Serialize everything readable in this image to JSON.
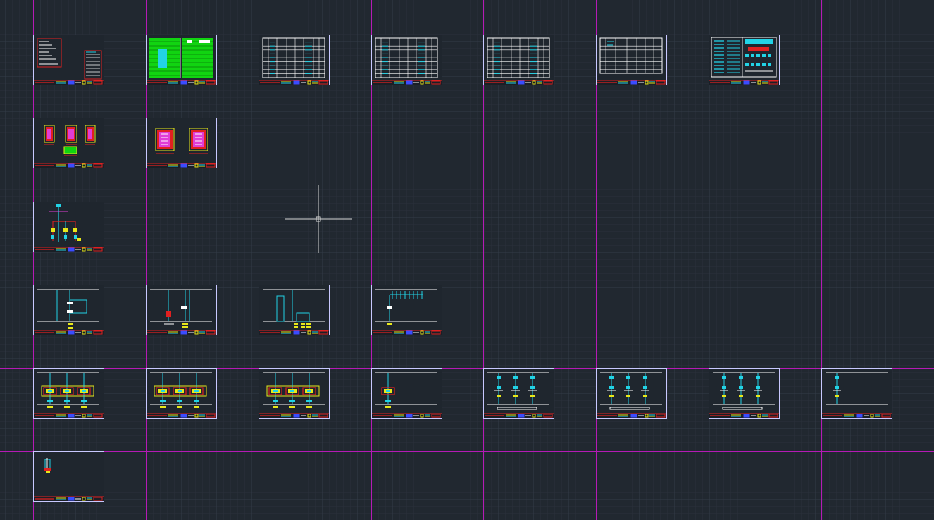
{
  "colors": {
    "background": "#212830",
    "grid_minor": "#2a313b",
    "grid_major": "#333b46",
    "layout_grid": "#b51ab5",
    "sheet_frame": "#c8c8ff",
    "cyan": "#22d3e6",
    "white": "#ffffff",
    "red": "#e12020",
    "yellow": "#e8e81a",
    "green": "#11d411",
    "magenta": "#e13dd6",
    "blue": "#3a4cff"
  },
  "cursor": {
    "icon": "crosshair-cursor-icon"
  },
  "sheets": [
    {
      "row": 0,
      "col": 0,
      "type": "cover"
    },
    {
      "row": 0,
      "col": 1,
      "type": "green-table"
    },
    {
      "row": 0,
      "col": 2,
      "type": "table"
    },
    {
      "row": 0,
      "col": 3,
      "type": "table"
    },
    {
      "row": 0,
      "col": 4,
      "type": "table"
    },
    {
      "row": 0,
      "col": 5,
      "type": "table-white"
    },
    {
      "row": 0,
      "col": 6,
      "type": "legend"
    },
    {
      "row": 1,
      "col": 0,
      "type": "panels-4"
    },
    {
      "row": 1,
      "col": 1,
      "type": "panels-2"
    },
    {
      "row": 2,
      "col": 0,
      "type": "riser"
    },
    {
      "row": 3,
      "col": 0,
      "type": "single-line-a"
    },
    {
      "row": 3,
      "col": 1,
      "type": "single-line-b"
    },
    {
      "row": 3,
      "col": 2,
      "type": "single-line-c"
    },
    {
      "row": 3,
      "col": 3,
      "type": "single-line-d"
    },
    {
      "row": 4,
      "col": 0,
      "type": "feeder-boxes",
      "n": 3
    },
    {
      "row": 4,
      "col": 1,
      "type": "feeder-boxes",
      "n": 3
    },
    {
      "row": 4,
      "col": 2,
      "type": "feeder-boxes",
      "n": 3
    },
    {
      "row": 4,
      "col": 3,
      "type": "feeder-boxes",
      "n": 1
    },
    {
      "row": 4,
      "col": 4,
      "type": "feeder-plain",
      "n": 3
    },
    {
      "row": 4,
      "col": 5,
      "type": "feeder-plain",
      "n": 3
    },
    {
      "row": 4,
      "col": 6,
      "type": "feeder-plain",
      "n": 3
    },
    {
      "row": 4,
      "col": 7,
      "type": "feeder-plain",
      "n": 1
    },
    {
      "row": 5,
      "col": 0,
      "type": "small-detail"
    }
  ]
}
